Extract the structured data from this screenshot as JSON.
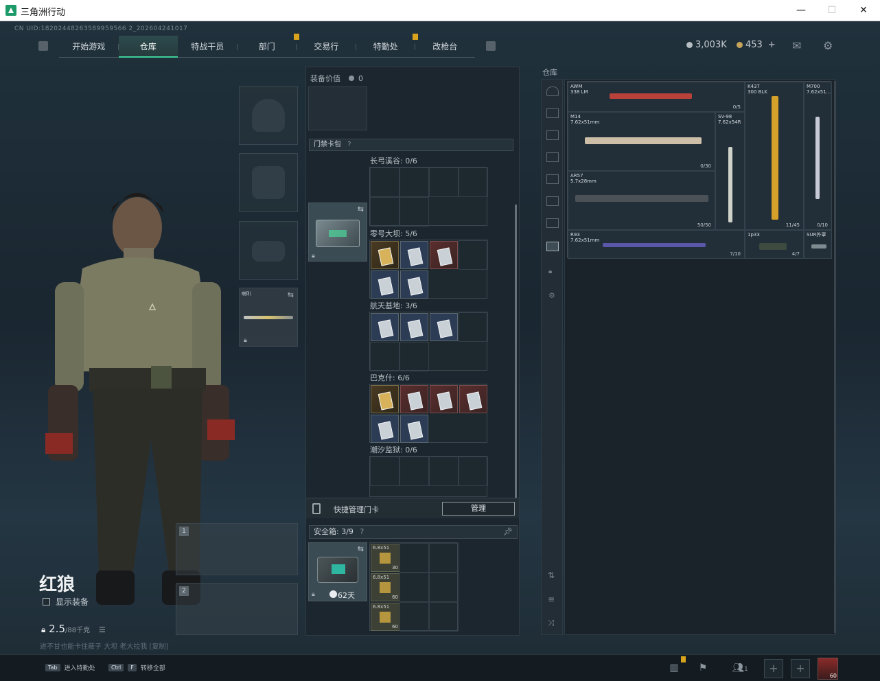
{
  "window": {
    "title": "三角洲行动",
    "minimize": "—",
    "maximize": "☐",
    "close": "✕"
  },
  "uid": "CN UID:18202448263589959566 2_202604241017",
  "nav": {
    "tabs": [
      "开始游戏",
      "仓库",
      "特战干员",
      "部门",
      "交易行",
      "特勤处",
      "改枪台"
    ],
    "active_index": 1,
    "badge_tabs": [
      3,
      5
    ]
  },
  "currency": {
    "silver": "3,003K",
    "gold": "453",
    "gold_plus": "+"
  },
  "agent": {
    "name": "红狼",
    "show_equip_label": "显示装备",
    "weight": "2.5",
    "weight_max": "/88千克",
    "quote": "进不甘也能卡住蔽子 大坝 老大拉我 [复制]"
  },
  "equip": {
    "melee_label": "喇叭",
    "weapon_slots": [
      "1",
      "2"
    ]
  },
  "middle": {
    "equip_value_label": "装备价值",
    "equip_value": "0",
    "keycard_section": "门禁卡包",
    "maps": [
      {
        "label": "长弓溪谷: 0/6"
      },
      {
        "label": "零号大坝: 5/6"
      },
      {
        "label": "航天基地: 3/6"
      },
      {
        "label": "巴克什: 6/6"
      },
      {
        "label": "潮汐监狱: 0/6"
      }
    ],
    "quick_manage_label": "快捷管理门卡",
    "manage_button": "管理",
    "safebox_label": "安全箱: 3/9",
    "safebox_days": "62天",
    "ammo": [
      {
        "name": "6.8x51",
        "count": "30"
      },
      {
        "name": "6.8x51",
        "count": "60"
      },
      {
        "name": "6.8x51",
        "count": "60"
      }
    ]
  },
  "stash": {
    "title": "仓库",
    "weapons": [
      {
        "name": "AWM",
        "sub": "338 LM",
        "count": "0/5",
        "color": "#b8413a"
      },
      {
        "name": "K437",
        "sub": "300 BLK",
        "count": "11/45",
        "color": "#d6a12a"
      },
      {
        "name": "M700",
        "sub": "7.62x51...",
        "count": "0/10",
        "color": "#c7c9d6"
      },
      {
        "name": "M14",
        "sub": "7.62x51mm",
        "count": "0/30",
        "color": "#cdbfa7"
      },
      {
        "name": "SV-98",
        "sub": "7.62x54R",
        "count": "",
        "color": "#cfd2c8"
      },
      {
        "name": "AR57",
        "sub": "5.7x28mm",
        "count": "50/50",
        "color": "#4b5257"
      },
      {
        "name": "R93",
        "sub": "7.62x51mm",
        "count": "7/10",
        "color": "#5a56a8"
      },
      {
        "name": "1p33",
        "sub": "",
        "count": "4/7",
        "color": "#3d4a3f"
      },
      {
        "name": "SUR外罩",
        "sub": "",
        "count": "",
        "color": "#7e8b91"
      }
    ]
  },
  "bottom": {
    "hint1_key": "Tab",
    "hint1_text": "进入特勤处",
    "hint2_key": "Ctrl",
    "hint2_key2": "F",
    "hint2_text": "转移全部",
    "squad_count": "1",
    "level": "60"
  }
}
